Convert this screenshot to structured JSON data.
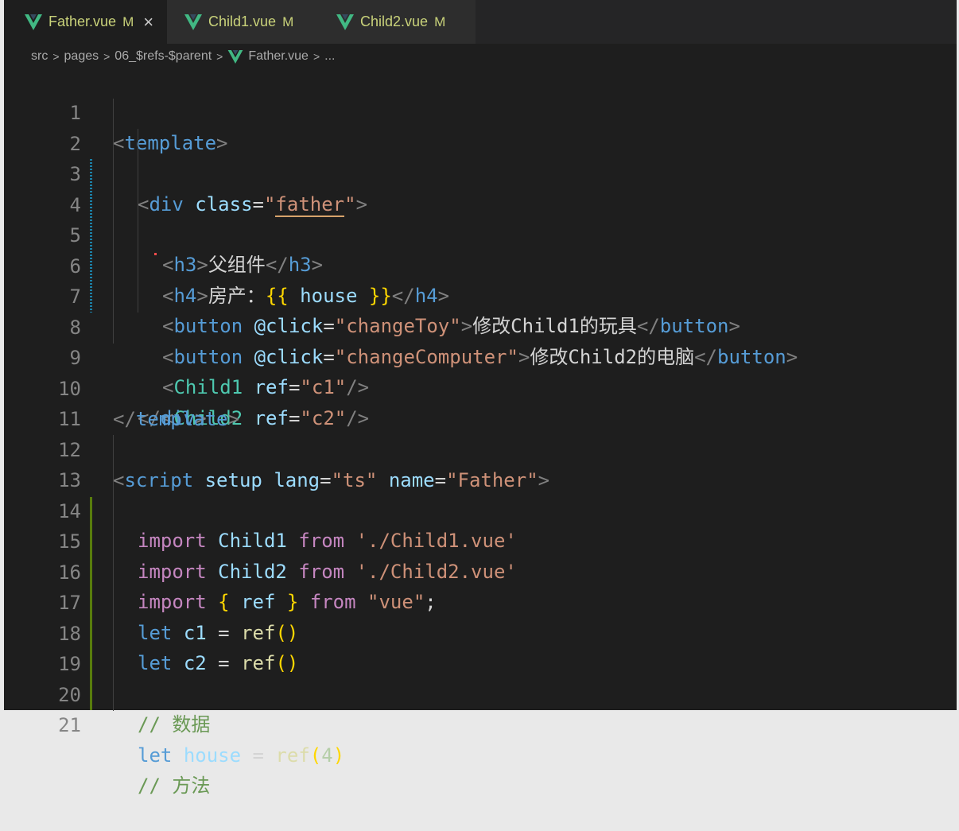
{
  "tabs": [
    {
      "label": "Father.vue",
      "status": "M",
      "active": true,
      "close": "×"
    },
    {
      "label": "Child1.vue",
      "status": "M",
      "active": false
    },
    {
      "label": "Child2.vue",
      "status": "M",
      "active": false
    }
  ],
  "breadcrumb": [
    "src",
    "pages",
    "06_$refs-$parent",
    "Father.vue",
    "..."
  ],
  "line_numbers": [
    "1",
    "2",
    "3",
    "4",
    "5",
    "6",
    "7",
    "8",
    "9",
    "10",
    "11",
    "12",
    "13",
    "14",
    "15",
    "16",
    "17",
    "18",
    "19",
    "20",
    "21"
  ],
  "code": {
    "l1": [
      "<",
      "template",
      ">"
    ],
    "l2": [
      "<",
      "div",
      "class",
      "=",
      "\"",
      "father",
      "\"",
      ">"
    ],
    "l3": [
      "<",
      "h3",
      ">",
      "父组件",
      "</",
      "h3",
      ">"
    ],
    "l4": [
      "<",
      "h4",
      ">",
      "房产：",
      "{{",
      "house",
      "}}",
      "</",
      "h4",
      ">"
    ],
    "l5": [
      "<",
      "button",
      "@click",
      "=",
      "\"changeToy\"",
      ">",
      "修改Child1的玩具",
      "</",
      "button",
      ">"
    ],
    "l6": [
      "<",
      "button",
      "@click",
      "=",
      "\"changeComputer\"",
      ">",
      "修改Child2的电脑",
      "</",
      "button",
      ">"
    ],
    "l7": [
      "<",
      "Child1",
      "ref",
      "=",
      "\"c1\"",
      "/>"
    ],
    "l8": [
      "<",
      "Child2",
      "ref",
      "=",
      "\"c2\"",
      "/>"
    ],
    "l9": [
      "</",
      "div",
      ">"
    ],
    "l10": [
      "</",
      "template",
      ">"
    ],
    "l12": [
      "<",
      "script",
      "setup",
      "lang",
      "=",
      "\"ts\"",
      "name",
      "=",
      "\"Father\"",
      ">"
    ],
    "l13": [
      "import",
      "Child1",
      "from",
      "'./Child1.vue'"
    ],
    "l14": [
      "import",
      "Child2",
      "from",
      "'./Child2.vue'"
    ],
    "l15": [
      "import",
      "{",
      "ref",
      "}",
      "from",
      "\"vue\"",
      ";"
    ],
    "l16": [
      "let",
      "c1",
      "=",
      "ref",
      "()"
    ],
    "l17": [
      "let",
      "c2",
      "=",
      "ref",
      "()"
    ],
    "l19": [
      "// 数据"
    ],
    "l20": [
      "let",
      "house",
      "=",
      "ref",
      "(",
      "4",
      ")"
    ],
    "l21": [
      "// 方法"
    ]
  },
  "colors": {
    "editor_bg": "#1e1e1e",
    "tag": "#569cd6",
    "string": "#ce9178",
    "attribute": "#9cdcfe",
    "keyword": "#c586c0",
    "component": "#4ec9b0",
    "comment": "#6a9955",
    "modified_tab": "#c9d27a"
  }
}
